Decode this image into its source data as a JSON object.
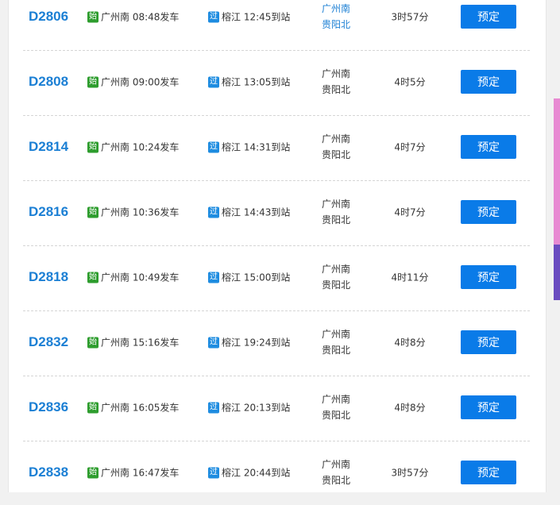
{
  "colors": {
    "train_no": "#1b7fd4",
    "start_badge": "#2e9d2e",
    "pass_badge": "#1e8ce0",
    "button": "#0a7be8"
  },
  "labels": {
    "start_badge": "始",
    "pass_badge": "过",
    "book": "预定"
  },
  "trains": [
    {
      "no": "D2806",
      "dep_station": "广州南",
      "dep_time": "08:48发车",
      "arr_station": "榕江",
      "arr_time": "12:45到站",
      "from": "广州南",
      "to": "贵阳北",
      "duration": "3时57分"
    },
    {
      "no": "D2808",
      "dep_station": "广州南",
      "dep_time": "09:00发车",
      "arr_station": "榕江",
      "arr_time": "13:05到站",
      "from": "广州南",
      "to": "贵阳北",
      "duration": "4时5分"
    },
    {
      "no": "D2814",
      "dep_station": "广州南",
      "dep_time": "10:24发车",
      "arr_station": "榕江",
      "arr_time": "14:31到站",
      "from": "广州南",
      "to": "贵阳北",
      "duration": "4时7分"
    },
    {
      "no": "D2816",
      "dep_station": "广州南",
      "dep_time": "10:36发车",
      "arr_station": "榕江",
      "arr_time": "14:43到站",
      "from": "广州南",
      "to": "贵阳北",
      "duration": "4时7分"
    },
    {
      "no": "D2818",
      "dep_station": "广州南",
      "dep_time": "10:49发车",
      "arr_station": "榕江",
      "arr_time": "15:00到站",
      "from": "广州南",
      "to": "贵阳北",
      "duration": "4时11分"
    },
    {
      "no": "D2832",
      "dep_station": "广州南",
      "dep_time": "15:16发车",
      "arr_station": "榕江",
      "arr_time": "19:24到站",
      "from": "广州南",
      "to": "贵阳北",
      "duration": "4时8分"
    },
    {
      "no": "D2836",
      "dep_station": "广州南",
      "dep_time": "16:05发车",
      "arr_station": "榕江",
      "arr_time": "20:13到站",
      "from": "广州南",
      "to": "贵阳北",
      "duration": "4时8分"
    },
    {
      "no": "D2838",
      "dep_station": "广州南",
      "dep_time": "16:47发车",
      "arr_station": "榕江",
      "arr_time": "20:44到站",
      "from": "广州南",
      "to": "贵阳北",
      "duration": "3时57分"
    }
  ]
}
